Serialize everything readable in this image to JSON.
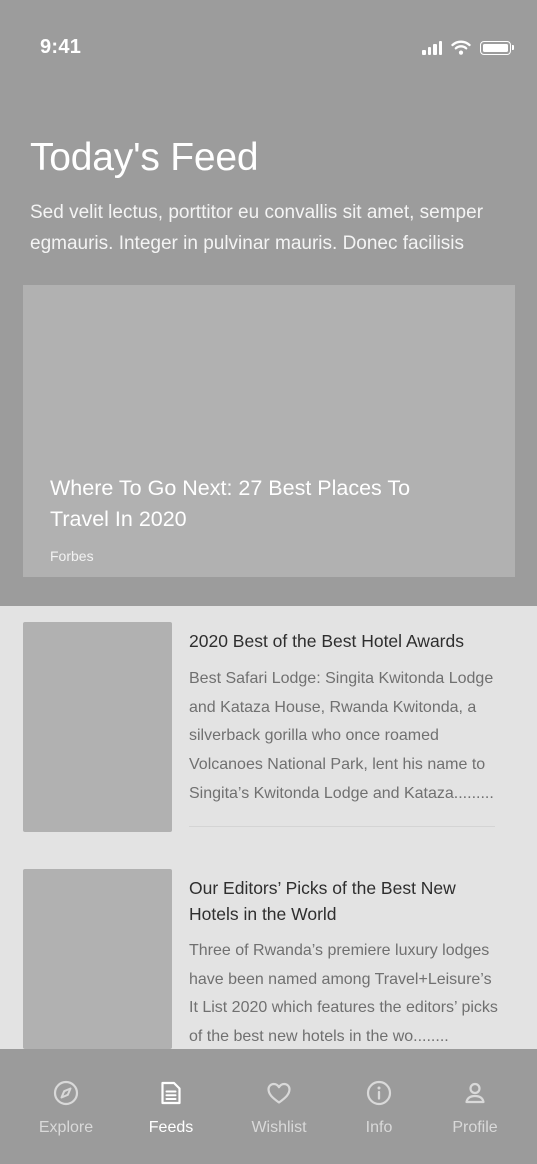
{
  "status_bar": {
    "time": "9:41"
  },
  "header": {
    "title": "Today's Feed",
    "subtitle": "Sed velit lectus, porttitor eu convallis sit amet, semper egmauris. Integer in pulvinar mauris. Donec facilisis"
  },
  "featured": {
    "title": "Where To Go Next: 27 Best Places To Travel In 2020",
    "source": "Forbes"
  },
  "articles": [
    {
      "title": "2020 Best of the Best Hotel Awards",
      "excerpt": "Best Safari Lodge: Singita Kwitonda Lodge and Kataza House, Rwanda Kwitonda, a silverback gorilla who once roamed Volcanoes National Park, lent his name to Singita’s Kwitonda Lodge and Kataza........."
    },
    {
      "title": "Our Editors’ Picks of the Best New Hotels in the World",
      "excerpt": "Three of Rwanda’s premiere luxury lodges have been named among Travel+Leisure’s It List 2020 which features the editors’ picks of the best new hotels in the wo........"
    }
  ],
  "tabs": [
    {
      "label": "Explore",
      "icon": "compass-icon",
      "active": false
    },
    {
      "label": "Feeds",
      "icon": "document-icon",
      "active": true
    },
    {
      "label": "Wishlist",
      "icon": "heart-icon",
      "active": false
    },
    {
      "label": "Info",
      "icon": "info-icon",
      "active": false
    },
    {
      "label": "Profile",
      "icon": "user-icon",
      "active": false
    }
  ],
  "colors": {
    "hero_background": "#9c9c9c",
    "card_placeholder": "#b1b1b1",
    "list_background": "#e3e3e3",
    "tab_bar_background": "#9b9b9b",
    "active_tab": "#ffffff",
    "inactive_tab": "#d9d9d9"
  }
}
